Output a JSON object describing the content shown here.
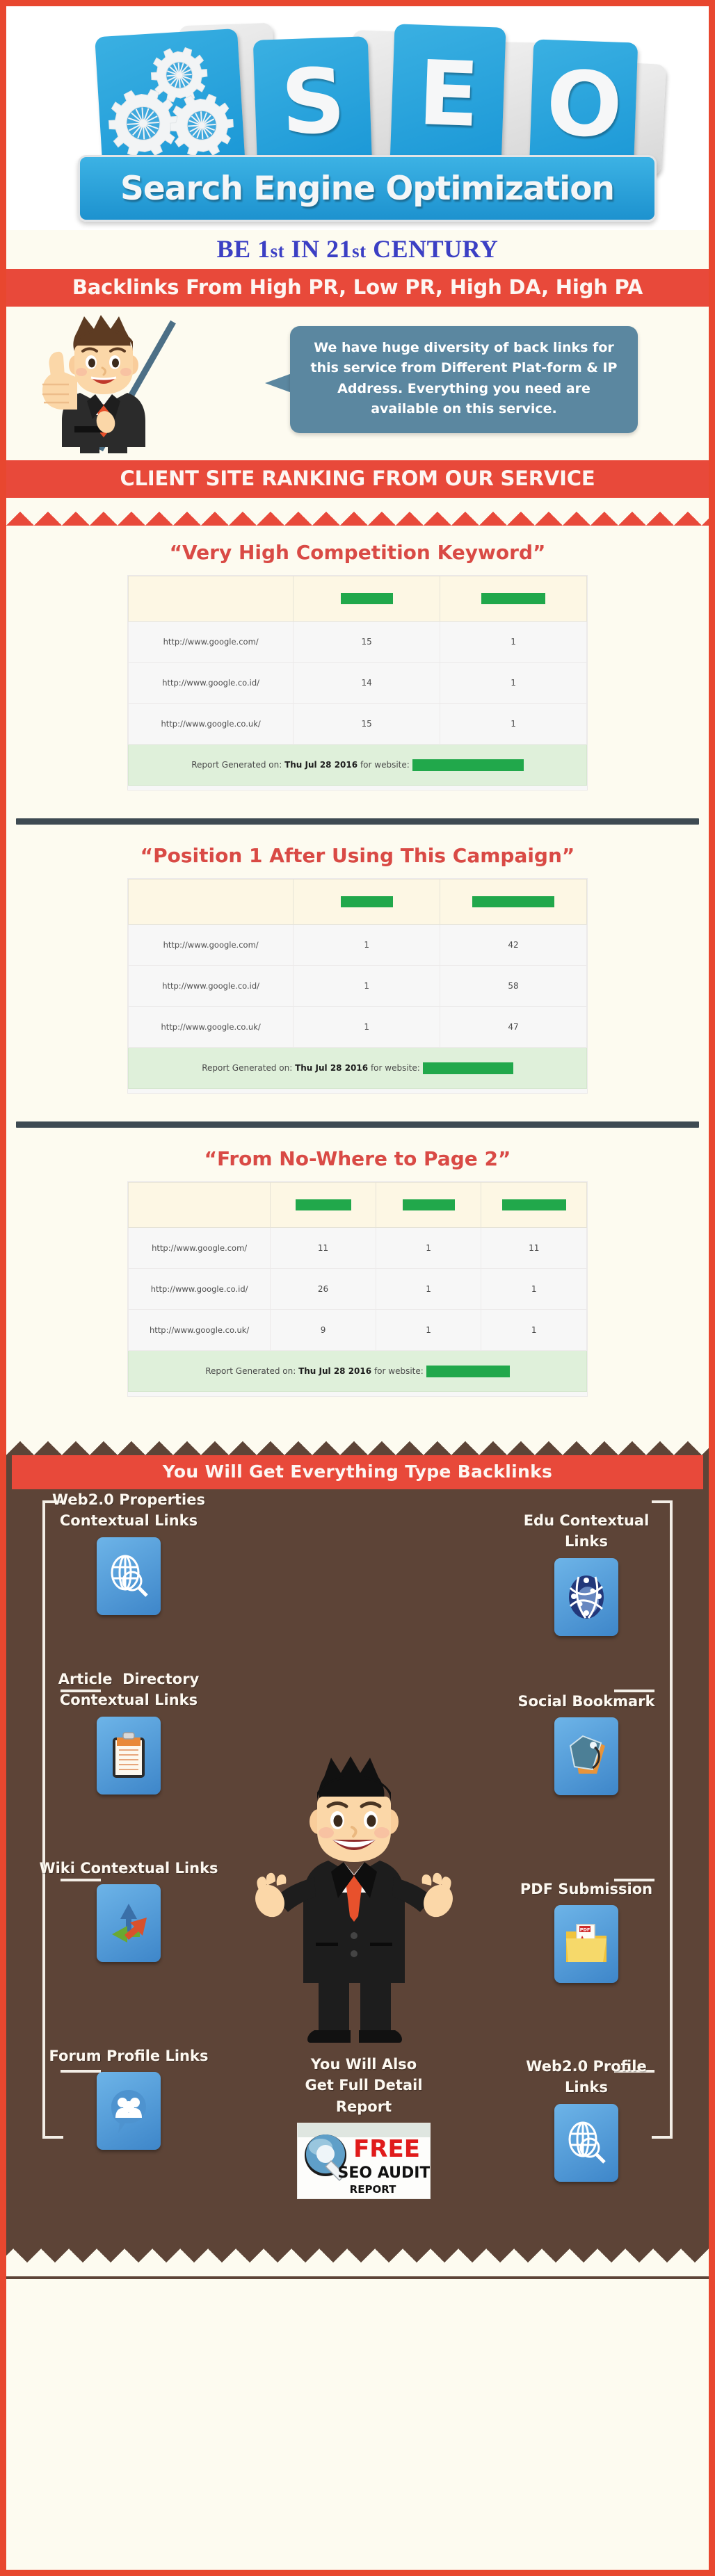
{
  "header": {
    "logo_letters": [
      "S",
      "E",
      "O"
    ],
    "logo_subtitle": "Search Engine Optimization",
    "gear_icon": "gears-icon"
  },
  "tagline": {
    "part1": "BE ",
    "num1": "1",
    "sup1": "st",
    "part2": " IN ",
    "num2": "21",
    "sup2": "st",
    "part3": " CENTURY",
    "full": "BE 1st IN 21st CENTURY"
  },
  "banner_backlinks": "Backlinks From High PR, Low PR, High DA, High PA",
  "intro": {
    "bubble_text": "We have huge diversity of back links for this service from Different Plat-form & IP Address. Everything you need are available on this service.",
    "character": "businessman-thumbs-up-illustration"
  },
  "banner_ranking": "CLIENT SITE RANKING FROM OUR SERVICE",
  "report_sections": [
    {
      "title": "“Very High Competition Keyword”",
      "header_cells": [
        "",
        "REDACTED",
        "REDACTED"
      ],
      "header_redact_widths": [
        75,
        92
      ],
      "rows": [
        {
          "url": "http://www.google.com/",
          "values": [
            "15",
            "1"
          ]
        },
        {
          "url": "http://www.google.co.id/",
          "values": [
            "14",
            "1"
          ]
        },
        {
          "url": "http://www.google.co.uk/",
          "values": [
            "15",
            "1"
          ]
        }
      ],
      "footer_prefix": "Report Generated on:",
      "footer_date": "Thu Jul 28 2016",
      "footer_suffix": "for website:"
    },
    {
      "title": "“Position 1 After Using This Campaign”",
      "header_cells": [
        "",
        "REDACTED",
        "REDACTED"
      ],
      "header_redact_widths": [
        75,
        118
      ],
      "rows": [
        {
          "url": "http://www.google.com/",
          "values": [
            "1",
            "42"
          ]
        },
        {
          "url": "http://www.google.co.id/",
          "values": [
            "1",
            "58"
          ]
        },
        {
          "url": "http://www.google.co.uk/",
          "values": [
            "1",
            "47"
          ]
        }
      ],
      "footer_prefix": "Report Generated on:",
      "footer_date": "Thu Jul 28 2016",
      "footer_suffix": "for website:"
    },
    {
      "title": "“From No-Where to Page 2”",
      "header_cells": [
        "",
        "REDACTED",
        "REDACTED",
        "REDACTED"
      ],
      "header_redact_widths": [
        80,
        75,
        92
      ],
      "rows": [
        {
          "url": "http://www.google.com/",
          "values": [
            "11",
            "1",
            "11"
          ]
        },
        {
          "url": "http://www.google.co.id/",
          "values": [
            "26",
            "1",
            "1"
          ]
        },
        {
          "url": "http://www.google.co.uk/",
          "values": [
            "9",
            "1",
            "1"
          ]
        }
      ],
      "footer_prefix": "Report Generated on:",
      "footer_date": "Thu Jul 28 2016",
      "footer_suffix": "for website:"
    }
  ],
  "banner_backlink_types": "You Will Get Everything Type Backlinks",
  "backlink_items_left": [
    {
      "label": "Web2.0 Properties\nContextual Links",
      "icon": "globe-search-icon"
    },
    {
      "label": "Article  Directory\nContextual Links",
      "icon": "clipboard-icon"
    },
    {
      "label": "Wiki Contextual Links",
      "icon": "recycle-arrows-icon"
    },
    {
      "label": "Forum Profile Links",
      "icon": "people-bubble-icon"
    }
  ],
  "backlink_items_right": [
    {
      "label": "Edu Contextual\nLinks",
      "icon": "network-globe-icon"
    },
    {
      "label": "Social Bookmark",
      "icon": "tag-bookmark-icon"
    },
    {
      "label": "PDF Submission",
      "icon": "pdf-folder-icon"
    },
    {
      "label": "Web2.0 Profile\nLinks",
      "icon": "globe-search-icon"
    }
  ],
  "center_block": {
    "label": "You Will Also\nGet Full Detail\nReport",
    "badge_free": "FREE",
    "badge_seo_audit": "SEO AUDIT",
    "badge_report": "REPORT",
    "badge_icon": "magnifier-icon",
    "character": "businessman-arms-open-illustration"
  },
  "colors": {
    "accent_red": "#e8493a",
    "brand_blue": "#1d92cf",
    "tagline_blue": "#3b3fc4",
    "title_red": "#d94a45",
    "redact_green": "#21a84b",
    "brown": "#5d4437",
    "cream": "#fdfbf0",
    "divider_slate": "#3e4a52",
    "bubble_blue": "#5b87a0"
  }
}
